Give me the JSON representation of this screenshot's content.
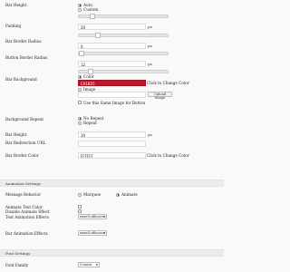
{
  "bar_height": {
    "label": "Bar Height",
    "options": [
      "Auto",
      "Custom"
    ],
    "selected": "Auto"
  },
  "padding": {
    "label": "Padding",
    "value": "20",
    "unit": "px",
    "slider_level": 0.2
  },
  "bar_border_radius": {
    "label": "Bar Border Radius",
    "value": "0",
    "unit": "px",
    "slider_level": 0.0
  },
  "button_border_radius": {
    "label": "Button Border Radius",
    "value": "12",
    "unit": "px",
    "slider_level": 0.12
  },
  "bar_background": {
    "label": "Bar Background",
    "color_option": "Color",
    "color_value": "C01B25",
    "color_hex": "#c0162a",
    "color_hint": "Click to Change Color",
    "image_option": "Image",
    "upload_label": "Upload Image",
    "same_image_label": "Use this Same Image for Button"
  },
  "background_repeat": {
    "label": "Background Repeat",
    "options": [
      "No Repeat",
      "Repeat"
    ],
    "selected": "No Repeat"
  },
  "bar_height_custom": {
    "label": "Bar Height",
    "value": "30",
    "unit": "px"
  },
  "bar_redirection_url": {
    "label": "Bar Redirection URL",
    "value": ""
  },
  "bar_border_color": {
    "label": "Bar Border Color",
    "value": "FFFFFF",
    "hint": "Click to Change Color"
  },
  "animation_settings": {
    "title": "Animation Settings",
    "message_behavior_label": "Message Behavior",
    "behavior_options": [
      "Marquee",
      "Animate"
    ],
    "behavior_selected": "Animate",
    "animate_text_color_label": "Animate Text Color",
    "disable_animate_label": "Disable Animate Effect",
    "text_effects_label": "Text Animation Effects",
    "text_effects_value": "easeOutBounce",
    "bar_effects_label": "Bar Animation Effects",
    "bar_effects_value": "easeOutBounce"
  },
  "font_settings": {
    "title": "Font Settings",
    "font_family_label": "Font Family",
    "font_family_value": "Cursive"
  }
}
